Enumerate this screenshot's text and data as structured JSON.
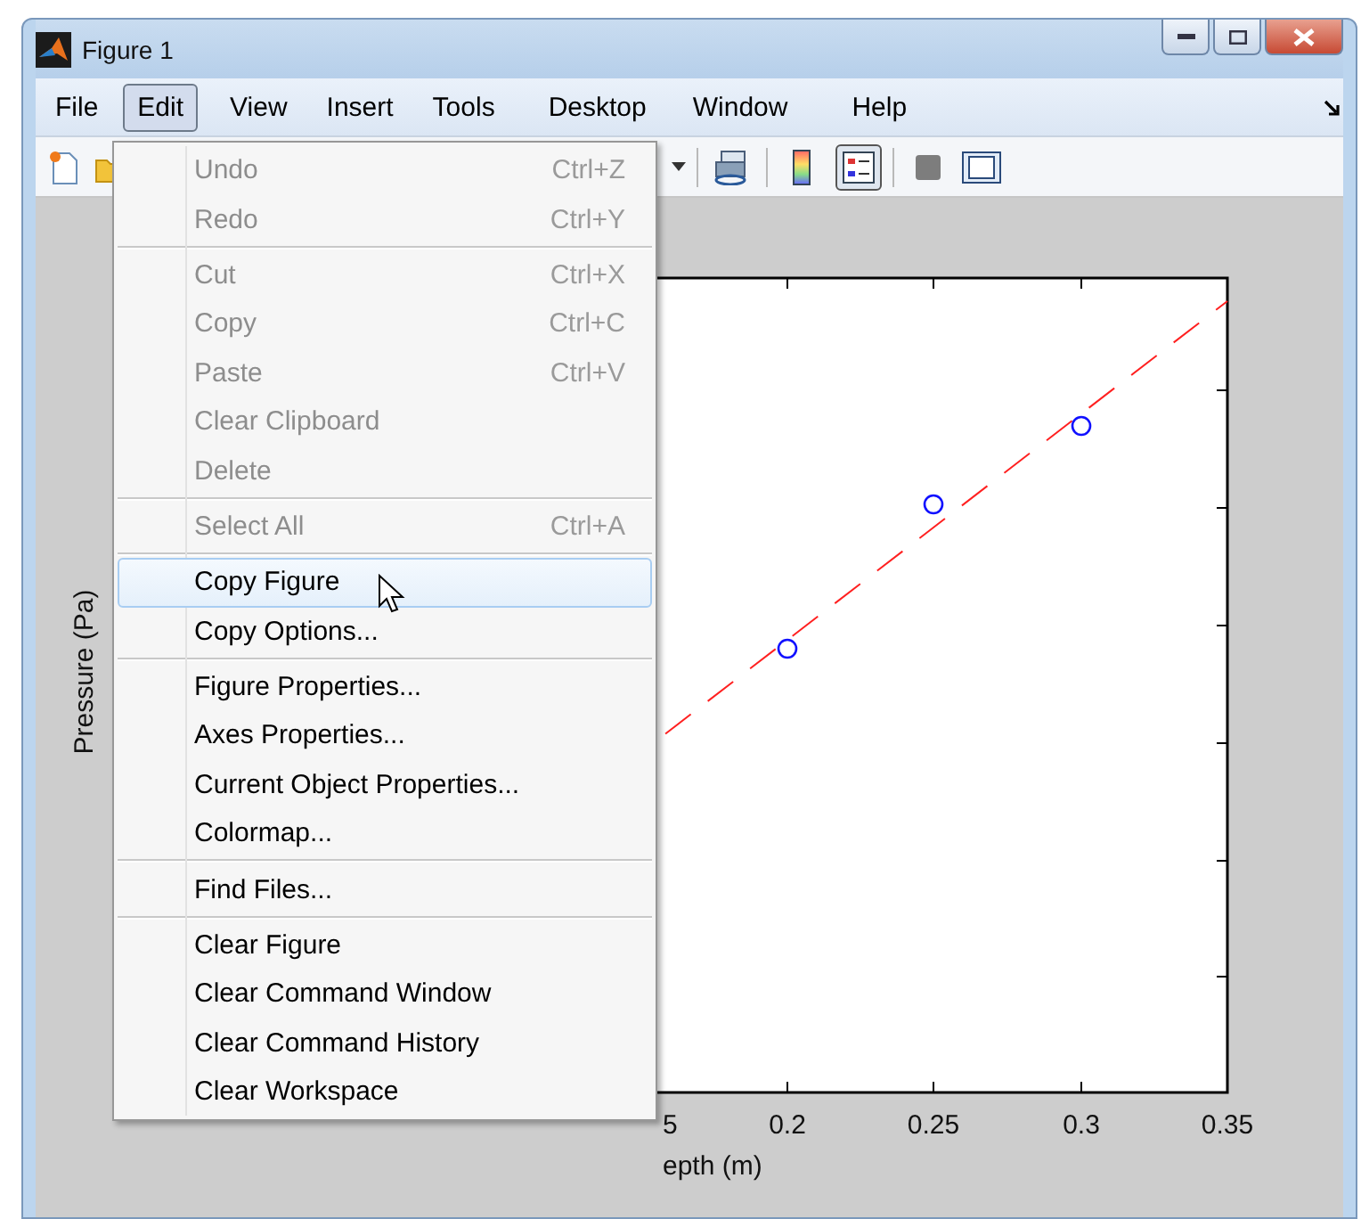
{
  "window": {
    "title": "Figure 1"
  },
  "menubar": [
    {
      "label": "File",
      "selected": false
    },
    {
      "label": "Edit",
      "selected": true
    },
    {
      "label": "View",
      "selected": false
    },
    {
      "label": "Insert",
      "selected": false
    },
    {
      "label": "Tools",
      "selected": false
    },
    {
      "label": "Desktop",
      "selected": false
    },
    {
      "label": "Window",
      "selected": false
    },
    {
      "label": "Help",
      "selected": false
    }
  ],
  "toolbar": {
    "pressed_legend": true
  },
  "plot": {
    "xtick_labels": [
      "5",
      "0.2",
      "0.25",
      "0.3",
      "0.35"
    ],
    "xlabel": "epth (m)",
    "ylabel": "Pressure (Pa)"
  },
  "edit_menu": {
    "groups": [
      [
        {
          "label": "Undo",
          "shortcut": "Ctrl+Z",
          "disabled": true,
          "selected": false
        },
        {
          "label": "Redo",
          "shortcut": "Ctrl+Y",
          "disabled": true,
          "selected": false
        }
      ],
      [
        {
          "label": "Cut",
          "shortcut": "Ctrl+X",
          "disabled": true,
          "selected": false
        },
        {
          "label": "Copy",
          "shortcut": "Ctrl+C",
          "disabled": true,
          "selected": false
        },
        {
          "label": "Paste",
          "shortcut": "Ctrl+V",
          "disabled": true,
          "selected": false
        },
        {
          "label": "Clear Clipboard",
          "disabled": true,
          "selected": false
        },
        {
          "label": "Delete",
          "disabled": true,
          "selected": false
        }
      ],
      [
        {
          "label": "Select All",
          "shortcut": "Ctrl+A",
          "disabled": true,
          "selected": false
        }
      ],
      [
        {
          "label": "Copy Figure",
          "disabled": false,
          "selected": true
        },
        {
          "label": "Copy Options...",
          "disabled": false,
          "selected": false
        }
      ],
      [
        {
          "label": "Figure Properties...",
          "disabled": false,
          "selected": false
        },
        {
          "label": "Axes Properties...",
          "disabled": false,
          "selected": false
        },
        {
          "label": "Current Object Properties...",
          "disabled": false,
          "selected": false
        },
        {
          "label": "Colormap...",
          "disabled": false,
          "selected": false
        }
      ],
      [
        {
          "label": "Find Files...",
          "disabled": false,
          "selected": false
        }
      ],
      [
        {
          "label": "Clear Figure",
          "disabled": false,
          "selected": false
        },
        {
          "label": "Clear Command Window",
          "disabled": false,
          "selected": false
        },
        {
          "label": "Clear Command History",
          "disabled": false,
          "selected": false
        },
        {
          "label": "Clear Workspace",
          "disabled": false,
          "selected": false
        }
      ]
    ]
  }
}
